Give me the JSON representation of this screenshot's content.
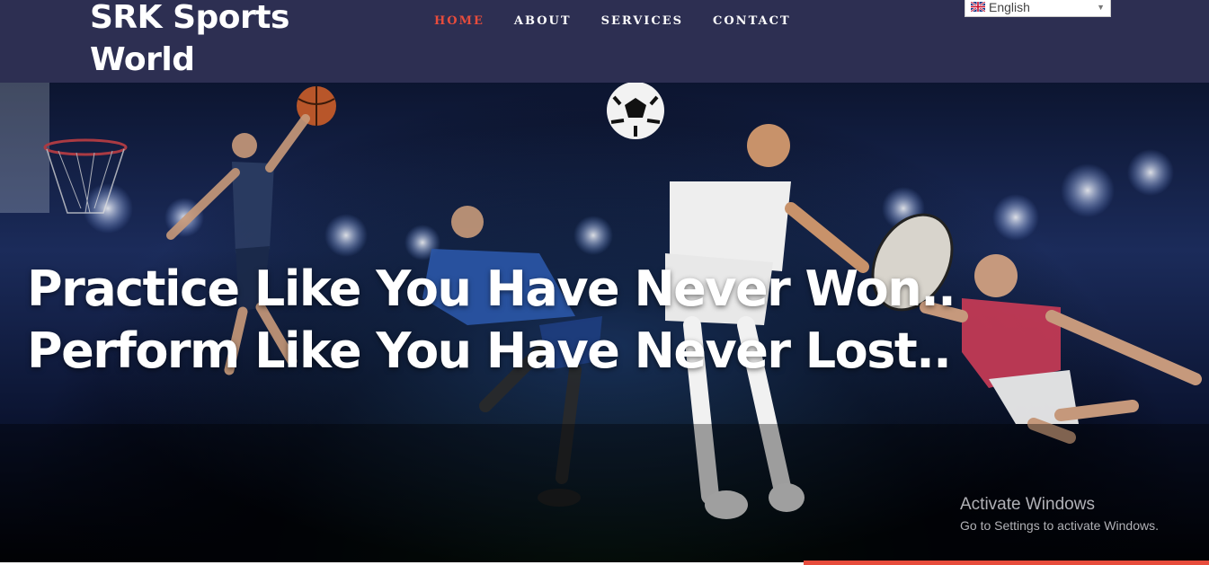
{
  "header": {
    "brand": "SRK Sports World",
    "nav": [
      {
        "label": "HOME",
        "active": true
      },
      {
        "label": "ABOUT",
        "active": false
      },
      {
        "label": "SERVICES",
        "active": false
      },
      {
        "label": "CONTACT",
        "active": false
      }
    ],
    "language": {
      "selected": "English",
      "icon": "uk-flag-icon"
    }
  },
  "hero": {
    "line1": "Practice Like You Have Never Won..",
    "line2": "Perform Like You Have Never Lost.."
  },
  "watermark": {
    "title": "Activate Windows",
    "subtitle": "Go to Settings to activate Windows."
  },
  "colors": {
    "header_bg": "#2d2f52",
    "accent": "#e74c3c",
    "text": "#ffffff"
  }
}
